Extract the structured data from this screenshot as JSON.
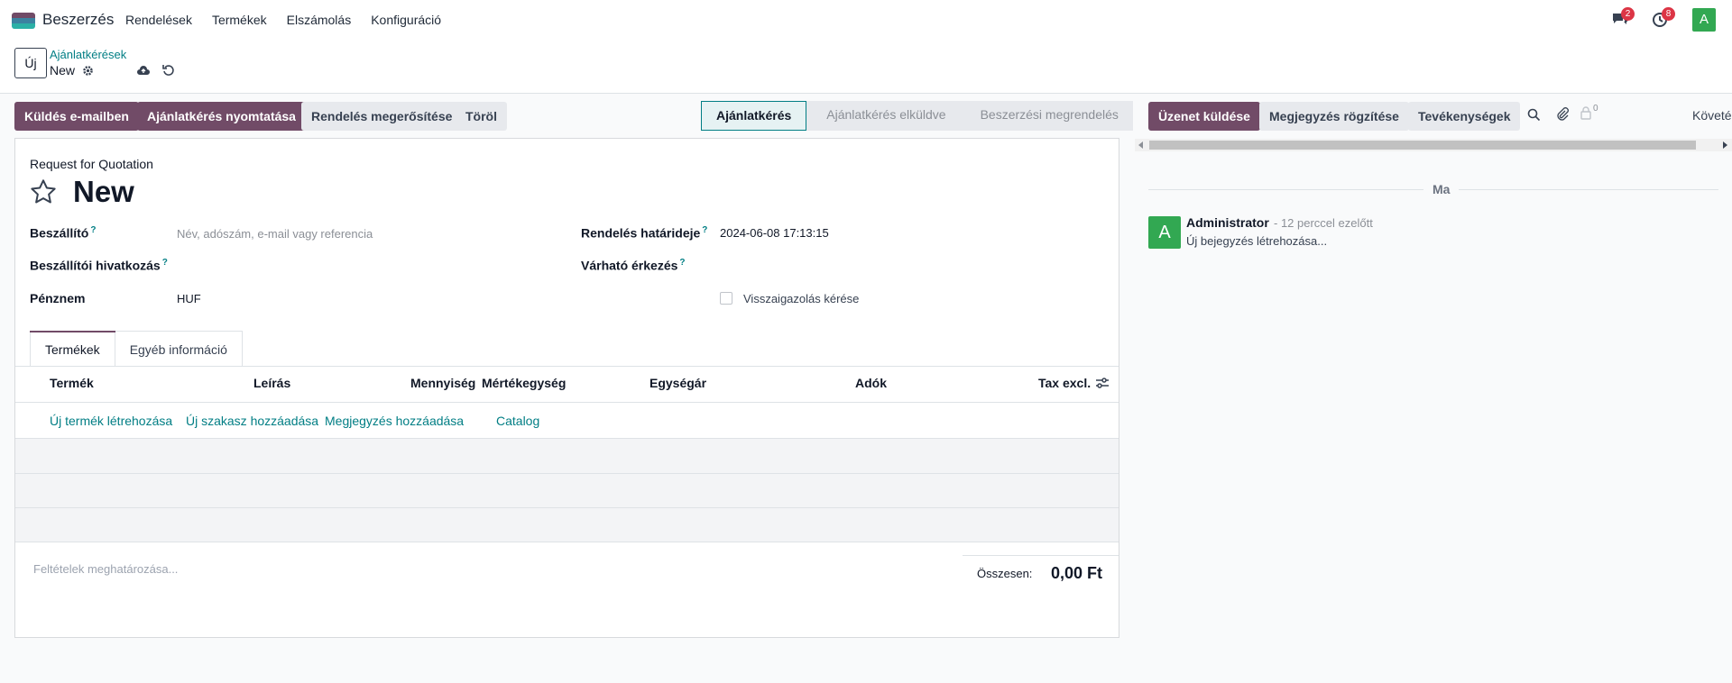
{
  "navbar": {
    "app_name": "Beszerzés",
    "menu": [
      "Rendelések",
      "Termékek",
      "Elszámolás",
      "Konfiguráció"
    ],
    "messages_badge": "2",
    "activities_badge": "8",
    "avatar_letter": "A"
  },
  "control": {
    "new_button": "Új",
    "breadcrumb_parent": "Ajánlatkérések",
    "breadcrumb_current": "New"
  },
  "actions": {
    "send_email": "Küldés e-mailben",
    "print_rfq": "Ajánlatkérés nyomtatása",
    "confirm_order": "Rendelés megerősítése",
    "delete": "Töröl"
  },
  "statusbar": [
    "Ajánlatkérés",
    "Ajánlatkérés elküldve",
    "Beszerzési megrendelés"
  ],
  "chatter": {
    "send_message": "Üzenet küldése",
    "log_note": "Megjegyzés rögzítése",
    "activities": "Tevékenységek",
    "followers_count": "0",
    "follow_label": "Követé",
    "date_separator": "Ma",
    "message_author": "Administrator",
    "message_time": "- 12 perccel ezelőtt",
    "message_body": "Új bejegyzés létrehozása..."
  },
  "form": {
    "subtitle": "Request for Quotation",
    "title": "New",
    "vendor_label": "Beszállító",
    "vendor_placeholder": "Név, adószám, e-mail vagy referencia",
    "vendor_ref_label": "Beszállítói hivatkozás",
    "currency_label": "Pénznem",
    "currency_value": "HUF",
    "deadline_label": "Rendelés határideje",
    "deadline_value": "2024-06-08 17:13:15",
    "expected_label": "Várható érkezés",
    "confirmation_label": "Visszaigazolás kérése",
    "help_mark": "?"
  },
  "tabs": [
    "Termékek",
    "Egyéb információ"
  ],
  "table": {
    "headers": [
      "Termék",
      "Leírás",
      "Mennyiség",
      "Mértékegység",
      "Egységár",
      "Adók",
      "Tax excl."
    ],
    "links": [
      "Új termék létrehozása",
      "Új szakasz hozzáadása",
      "Megjegyzés hozzáadása",
      "Catalog"
    ]
  },
  "footer": {
    "terms_placeholder": "Feltételek meghatározása...",
    "total_label": "Összesen:",
    "total_value": "0,00 Ft"
  },
  "colors": {
    "primary": "#714b67",
    "teal": "#017e84",
    "avatar": "#32a852",
    "badge": "#dc3545"
  }
}
